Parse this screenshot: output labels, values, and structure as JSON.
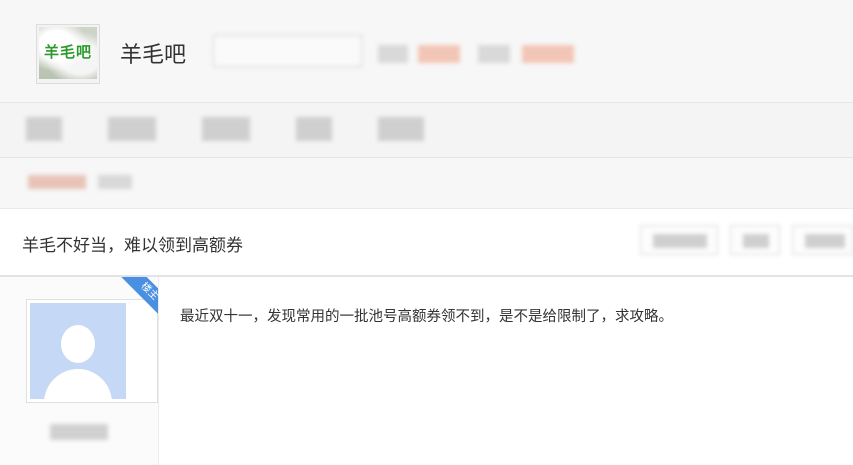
{
  "header": {
    "logo_text": "羊毛吧",
    "forum_name": "羊毛吧",
    "follow_placeholder": "",
    "stats": []
  },
  "nav": {
    "items_count": 5
  },
  "post": {
    "title": "羊毛不好当，难以领到高额券",
    "badge": "楼主",
    "content": "最近双十一，发现常用的一批池号高额券领不到，是不是给限制了，求攻略。"
  },
  "colors": {
    "badge_blue": "#4a90e2",
    "avatar_bg": "#c5d9f6",
    "logo_text_green": "#2d9a2d"
  },
  "icons": [
    "default-avatar-icon"
  ]
}
